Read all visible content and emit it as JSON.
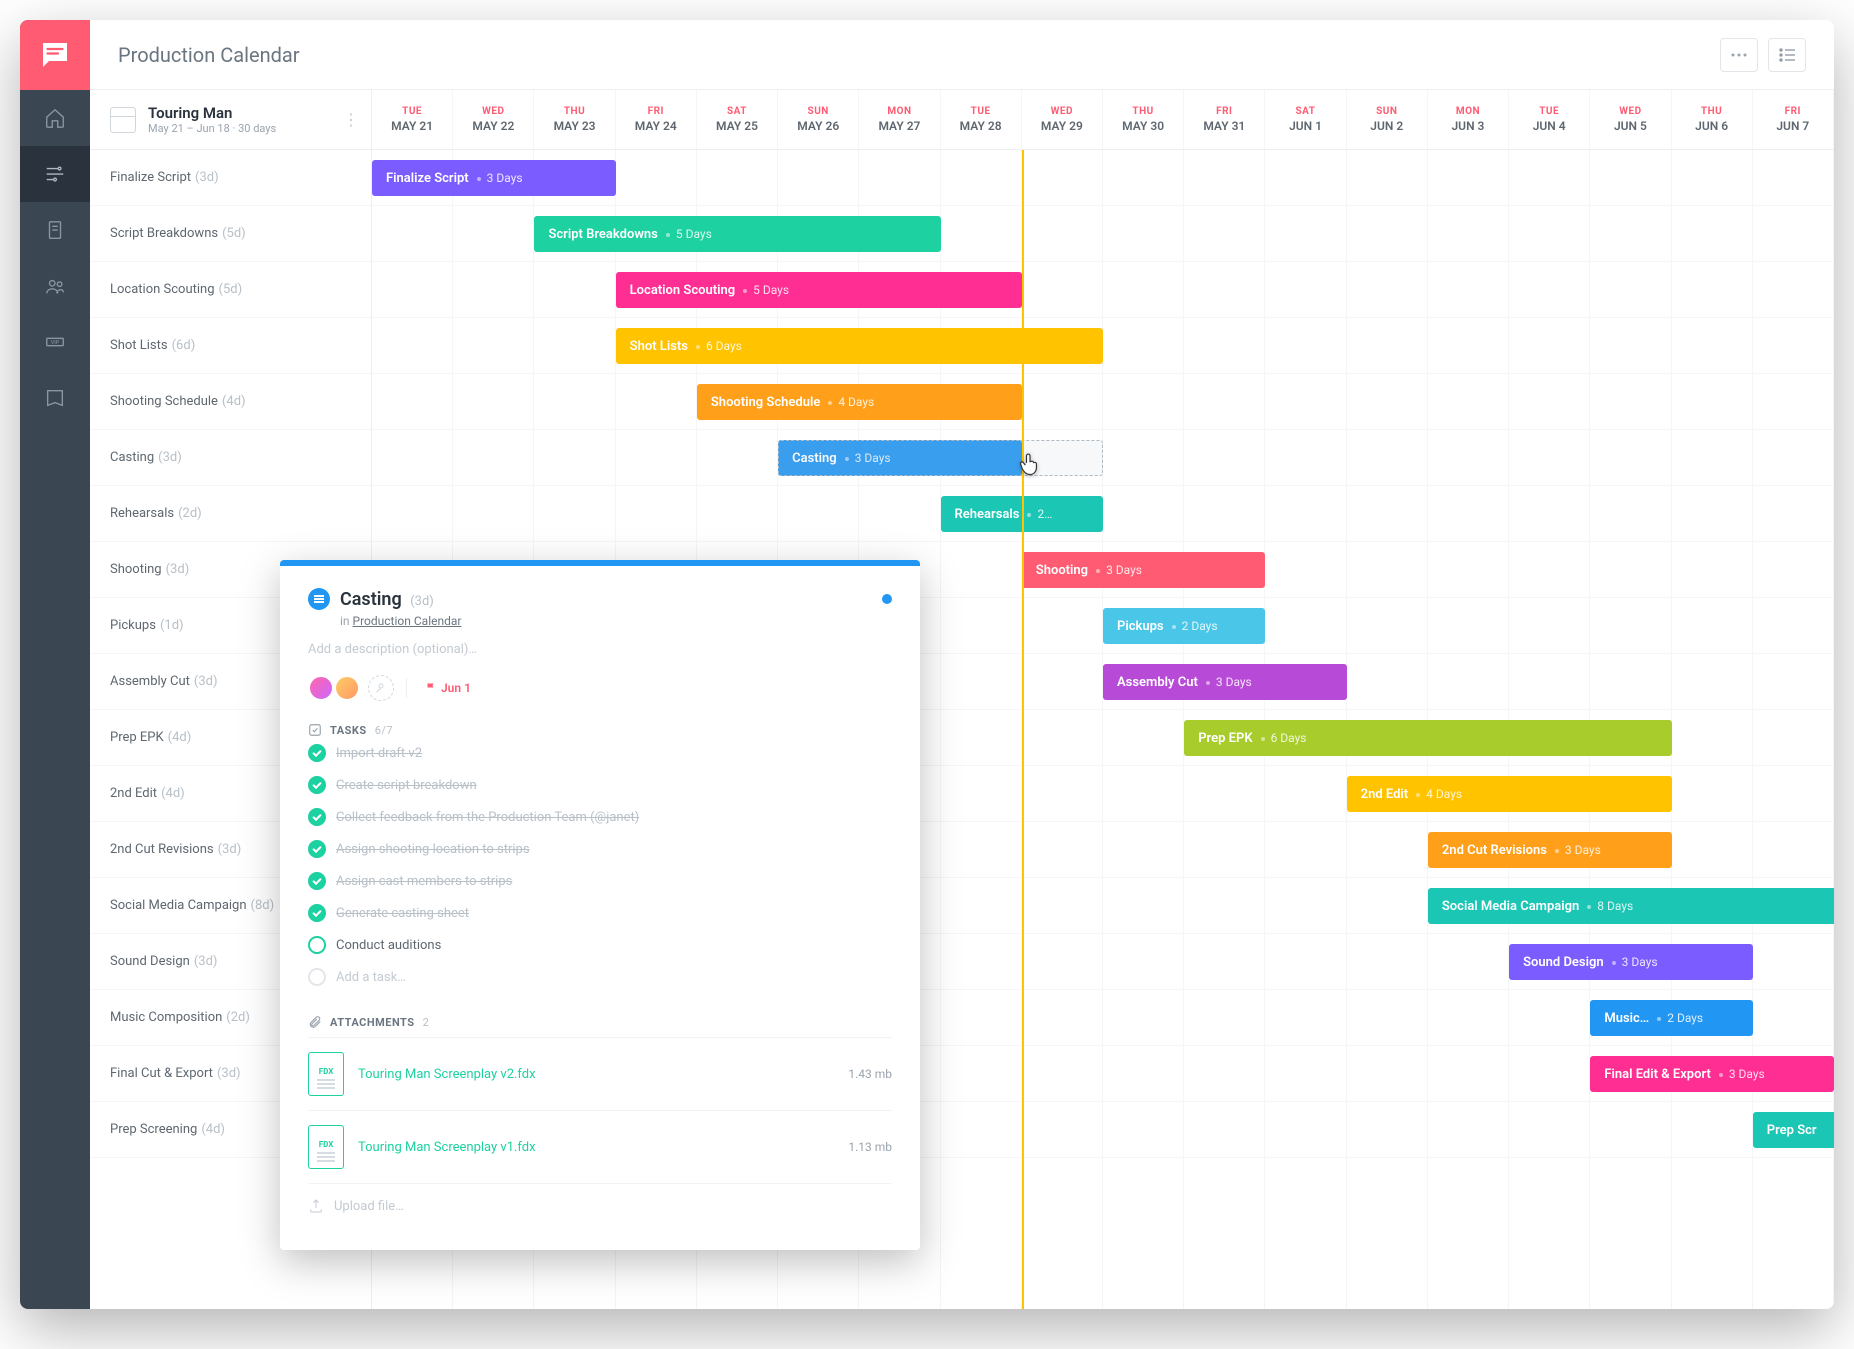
{
  "header": {
    "title": "Production Calendar"
  },
  "project": {
    "name": "Touring Man",
    "range": "May 21 – Jun 18 · 30 days"
  },
  "days": [
    {
      "dow": "TUE",
      "date": "MAY 21"
    },
    {
      "dow": "WED",
      "date": "MAY 22"
    },
    {
      "dow": "THU",
      "date": "MAY 23"
    },
    {
      "dow": "FRI",
      "date": "MAY 24"
    },
    {
      "dow": "SAT",
      "date": "MAY 25"
    },
    {
      "dow": "SUN",
      "date": "MAY 26"
    },
    {
      "dow": "MON",
      "date": "MAY 27"
    },
    {
      "dow": "TUE",
      "date": "MAY 28"
    },
    {
      "dow": "WED",
      "date": "MAY 29"
    },
    {
      "dow": "THU",
      "date": "MAY 30"
    },
    {
      "dow": "FRI",
      "date": "MAY 31"
    },
    {
      "dow": "SAT",
      "date": "JUN 1"
    },
    {
      "dow": "SUN",
      "date": "JUN 2"
    },
    {
      "dow": "MON",
      "date": "JUN 3"
    },
    {
      "dow": "TUE",
      "date": "JUN 4"
    },
    {
      "dow": "WED",
      "date": "JUN 5"
    },
    {
      "dow": "THU",
      "date": "JUN 6"
    },
    {
      "dow": "FRI",
      "date": "JUN 7"
    }
  ],
  "today_index": 8,
  "tasks": [
    {
      "name": "Finalize Script",
      "dur": "3d",
      "bar_dur": "3 Days",
      "start": 0,
      "span": 3,
      "color": "#7b5cff"
    },
    {
      "name": "Script Breakdowns",
      "dur": "5d",
      "bar_dur": "5 Days",
      "start": 2,
      "span": 5,
      "color": "#1dd1a1"
    },
    {
      "name": "Location Scouting",
      "dur": "5d",
      "bar_dur": "5 Days",
      "start": 3,
      "span": 5,
      "color": "#ff2e92"
    },
    {
      "name": "Shot Lists",
      "dur": "6d",
      "bar_dur": "6 Days",
      "start": 3,
      "span": 6,
      "color": "#ffc300"
    },
    {
      "name": "Shooting Schedule",
      "dur": "4d",
      "bar_dur": "4 Days",
      "start": 4,
      "span": 4,
      "color": "#ff9f1a"
    },
    {
      "name": "Casting",
      "dur": "3d",
      "bar_dur": "3 Days",
      "start": 5,
      "span": 3,
      "color": "#2196f3",
      "drag_extend": 1
    },
    {
      "name": "Rehearsals",
      "dur": "2d",
      "bar_dur": "2…",
      "start": 7,
      "span": 2,
      "color": "#1bc6b4"
    },
    {
      "name": "Shooting",
      "dur": "3d",
      "bar_dur": "3 Days",
      "start": 8,
      "span": 3,
      "color": "#ff5b72"
    },
    {
      "name": "Pickups",
      "dur": "1d",
      "bar_dur": "2 Days",
      "start": 9,
      "span": 2,
      "color": "#4ac7e8"
    },
    {
      "name": "Assembly Cut",
      "dur": "3d",
      "bar_dur": "3 Days",
      "start": 9,
      "span": 3,
      "color": "#b84ad8"
    },
    {
      "name": "Prep EPK",
      "dur": "4d",
      "bar_dur": "6 Days",
      "start": 10,
      "span": 6,
      "color": "#a8cc2b"
    },
    {
      "name": "2nd Edit",
      "dur": "4d",
      "bar_dur": "4 Days",
      "start": 12,
      "span": 4,
      "color": "#ffc300"
    },
    {
      "name": "2nd Cut Revisions",
      "dur": "3d",
      "bar_dur": "3 Days",
      "start": 13,
      "span": 3,
      "color": "#ff9f1a"
    },
    {
      "name": "Social Media Campaign",
      "dur": "8d",
      "bar_dur": "8 Days",
      "start": 13,
      "span": 8,
      "color": "#1bc6b4"
    },
    {
      "name": "Sound Design",
      "dur": "3d",
      "bar_dur": "3 Days",
      "start": 14,
      "span": 3,
      "color": "#7b5cff"
    },
    {
      "name": "Music Composition",
      "dur": "2d",
      "bar_label": "Music…",
      "bar_dur": "2 Days",
      "start": 15,
      "span": 2,
      "color": "#2196f3"
    },
    {
      "name": "Final Cut & Export",
      "dur": "3d",
      "bar_label": "Final Edit & Export",
      "bar_dur": "3 Days",
      "start": 15,
      "span": 3,
      "color": "#ff2e92"
    },
    {
      "name": "Prep Screening",
      "dur": "4d",
      "bar_label": "Prep Scr",
      "bar_dur": "",
      "start": 17,
      "span": 4,
      "color": "#1bc6b4"
    }
  ],
  "popup": {
    "title": "Casting",
    "dur": "(3d)",
    "in_label": "in ",
    "in_link": "Production Calendar",
    "desc_placeholder": "Add a description (optional)…",
    "due": "Jun 1",
    "tasks_heading": "TASKS",
    "tasks_count": "6/7",
    "subtasks": [
      {
        "text": "Import draft v2",
        "done": true
      },
      {
        "text": "Create script breakdown",
        "done": true
      },
      {
        "text": "Collect feedback from the Production Team (@janet)",
        "done": true
      },
      {
        "text": "Assign shooting location to strips",
        "done": true
      },
      {
        "text": "Assign cast members to strips",
        "done": true
      },
      {
        "text": "Generate casting sheet",
        "done": true
      },
      {
        "text": "Conduct auditions",
        "done": false
      }
    ],
    "add_task": "Add a task…",
    "attach_heading": "ATTACHMENTS",
    "attach_count": "2",
    "attachments": [
      {
        "ext": "FDX",
        "name": "Touring Man Screenplay v2.fdx",
        "size": "1.43 mb"
      },
      {
        "ext": "FDX",
        "name": "Touring Man Screenplay v1.fdx",
        "size": "1.13 mb"
      }
    ],
    "upload": "Upload file…"
  }
}
